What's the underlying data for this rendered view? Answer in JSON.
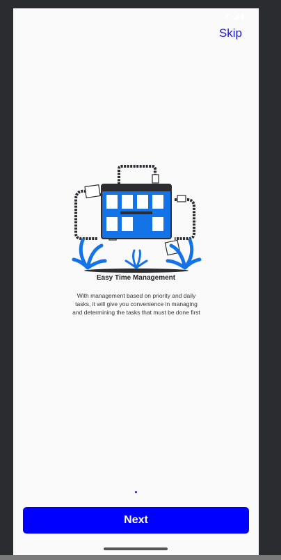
{
  "status_bar": {
    "time": "",
    "icons": "▼◢▮"
  },
  "header": {
    "skip_label": "Skip"
  },
  "onboarding": {
    "illustration": "calendar-time-management-illustration",
    "title": "Easy Time Management",
    "description": "With management based on priority and daily tasks, it will give you convenience in managing and determining the tasks that must be done first"
  },
  "footer": {
    "next_label": "Next"
  },
  "colors": {
    "accent": "#0000ff",
    "link": "#1d1bd0",
    "illustration_blue": "#1473e6",
    "dark": "#2b2c30"
  }
}
